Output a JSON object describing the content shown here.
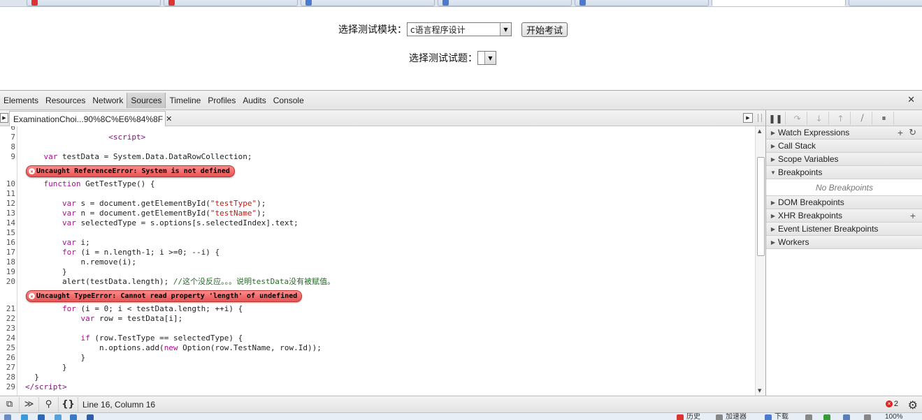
{
  "page": {
    "module_label": "选择测试模块：",
    "module_value": "c语言程序设计",
    "start_button": "开始考试",
    "question_label": "选择测试试题：",
    "question_value": ""
  },
  "devtools": {
    "panels": [
      "Elements",
      "Resources",
      "Network",
      "Sources",
      "Timeline",
      "Profiles",
      "Audits",
      "Console"
    ],
    "active_panel": "Sources",
    "file_tab": "ExaminationChoi...90%8C%E6%84%8F",
    "errors": [
      "Uncaught ReferenceError: System is not defined",
      "Uncaught TypeError: Cannot read property 'length' of undefined"
    ],
    "status_position": "Line 16, Column 16",
    "error_count": "2",
    "sidebar": {
      "watch": "Watch Expressions",
      "call_stack": "Call Stack",
      "scope": "Scope Variables",
      "breakpoints": "Breakpoints",
      "no_breakpoints": "No Breakpoints",
      "dom_bp": "DOM Breakpoints",
      "xhr_bp": "XHR Breakpoints",
      "event_bp": "Event Listener Breakpoints",
      "workers": "Workers"
    },
    "gutter": [
      "6",
      "7",
      "8",
      "9",
      "10",
      "11",
      "12",
      "13",
      "14",
      "15",
      "16",
      "17",
      "18",
      "19",
      "20",
      "21",
      "22",
      "23",
      "24",
      "25",
      "26",
      "27",
      "28",
      "29"
    ]
  },
  "taskbar": {
    "items": [
      "历史",
      "加速器",
      "下载"
    ],
    "zoom": "100%"
  }
}
